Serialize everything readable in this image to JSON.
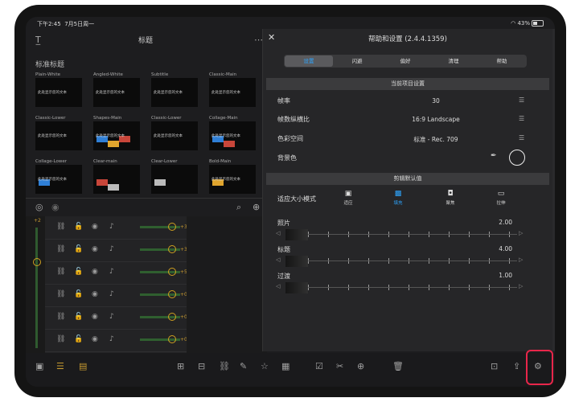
{
  "status": {
    "time": "下午2:45",
    "date": "7月5日周一",
    "battery": "43%"
  },
  "app": {
    "title": "标题",
    "section": "标准标题"
  },
  "titles": [
    {
      "label": "Plain-White",
      "caption": "此处显示您的文本"
    },
    {
      "label": "Angled-White",
      "caption": "此处显示您的文本"
    },
    {
      "label": "Subtitle",
      "caption": "此处显示您的文本"
    },
    {
      "label": "Classic-Main",
      "caption": "此处显示您的文本"
    },
    {
      "label": "Classic-Lower",
      "caption": "此处显示您的文本"
    },
    {
      "label": "Shapes-Main",
      "caption": "此处显示您的文本"
    },
    {
      "label": "Classic-Lower",
      "caption": "此处显示您的文本"
    },
    {
      "label": "Collage-Main",
      "caption": "此处显示您的文本"
    },
    {
      "label": "Collage-Lower",
      "caption": "此处显示您的文本"
    },
    {
      "label": "Clear-main",
      "caption": ""
    },
    {
      "label": "Clear-Lower",
      "caption": ""
    },
    {
      "label": "Bold-Main",
      "caption": "此处显示您的文本"
    }
  ],
  "tracks": [
    {
      "num": "+3"
    },
    {
      "num": "+3"
    },
    {
      "num": "+5"
    },
    {
      "num": "+0"
    },
    {
      "num": "+0"
    },
    {
      "num": "+0"
    }
  ],
  "track_top_num": "+2",
  "modal": {
    "title": "帮助和设置 (2.4.4.1359)",
    "tabs": [
      "设置",
      "闪避",
      "偏好",
      "清理",
      "帮助"
    ],
    "active_tab": "设置",
    "section1": "当前项目设置",
    "frame_rate_label": "帧率",
    "frame_rate_value": "30",
    "aspect_label": "帧数纵横比",
    "aspect_value": "16:9 Landscape",
    "color_label": "色彩空间",
    "color_value": "标准 - Rec. 709",
    "bg_label": "背景色",
    "section2": "剪辑默认值",
    "fit_label": "适应大小模式",
    "fit_options": [
      "适应",
      "填充",
      "聚焦",
      "拉伸"
    ],
    "fit_active": "填充",
    "photo_label": "照片",
    "photo_value": "2.00",
    "title_label": "标题",
    "title_value": "4.00",
    "transition_label": "过渡",
    "transition_value": "1.00"
  },
  "colors": {
    "accent": "#2ea6ff",
    "highlight": "#e8264a"
  }
}
